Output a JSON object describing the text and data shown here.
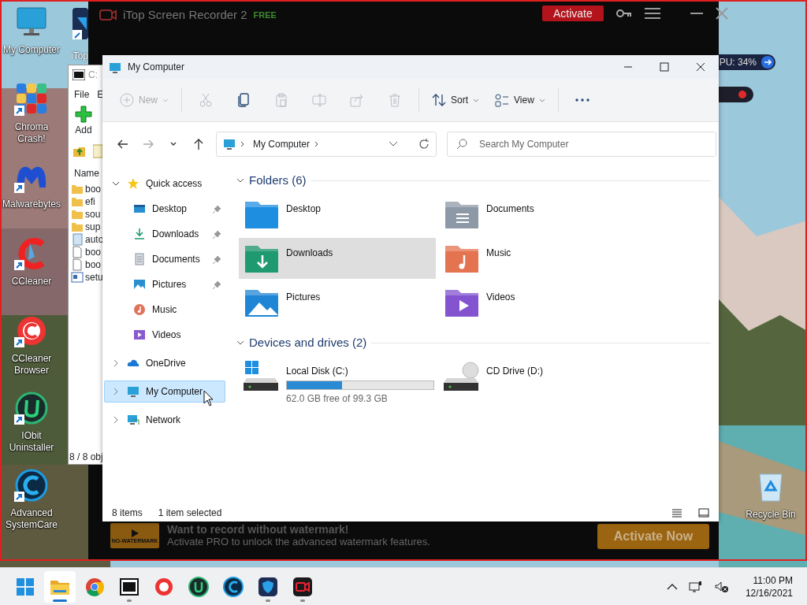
{
  "desktop_icons": [
    {
      "label": "My Computer",
      "kind": "computer"
    },
    {
      "label": "Chroma Crash!",
      "kind": "chroma"
    },
    {
      "label": "Malwarebytes",
      "kind": "malwarebytes"
    },
    {
      "label": "CCleaner",
      "kind": "ccleaner"
    },
    {
      "label": "CCleaner Browser",
      "kind": "ccbrowser"
    },
    {
      "label": "IObit Uninstaller",
      "kind": "iobit"
    },
    {
      "label": "Advanced SystemCare",
      "kind": "asc"
    }
  ],
  "partial_icon": {
    "label": "iTop"
  },
  "recycle_bin": {
    "label": "Recycle Bin"
  },
  "recorder": {
    "title": "iTop Screen Recorder 2",
    "edition": "FREE",
    "activate_button": "Activate",
    "cpu_badge": "PU: 34%",
    "promo": {
      "badge": "NO-WATERMARK",
      "heading": "Want to record without watermark!",
      "text": "Activate PRO to unlock the advanced watermark features.",
      "button": "Activate Now"
    }
  },
  "sevenzip": {
    "title": "C:",
    "menu": [
      "File",
      "E"
    ],
    "add_button": "Add",
    "column": "Name",
    "rows": [
      {
        "name": "boo",
        "kind": "folder"
      },
      {
        "name": "efi",
        "kind": "folder"
      },
      {
        "name": "sou",
        "kind": "folder"
      },
      {
        "name": "sup",
        "kind": "folder"
      },
      {
        "name": "auto",
        "kind": "setup"
      },
      {
        "name": "boo",
        "kind": "file"
      },
      {
        "name": "boo",
        "kind": "file"
      },
      {
        "name": "setu",
        "kind": "app"
      }
    ],
    "status": "8 / 8 obj"
  },
  "explorer": {
    "title": "My Computer",
    "toolbar": [
      [
        {
          "kind": "new",
          "label": "New",
          "disabled": true
        }
      ],
      [
        {
          "kind": "cut",
          "disabled": true
        },
        {
          "kind": "copy",
          "disabled": false
        },
        {
          "kind": "paste",
          "disabled": true
        },
        {
          "kind": "rename",
          "disabled": true
        },
        {
          "kind": "share",
          "disabled": true
        },
        {
          "kind": "delete",
          "disabled": true
        }
      ],
      [
        {
          "kind": "sort",
          "label": "Sort",
          "disabled": false
        },
        {
          "kind": "view",
          "label": "View",
          "disabled": false
        }
      ],
      [
        {
          "kind": "more",
          "disabled": false
        }
      ]
    ],
    "nav_buttons": [
      {
        "kind": "back",
        "disabled": false
      },
      {
        "kind": "forward",
        "disabled": true
      },
      {
        "kind": "recent",
        "disabled": false
      },
      {
        "kind": "up",
        "disabled": false
      }
    ],
    "address": "My Computer",
    "search_placeholder": "Search My Computer",
    "nav": [
      {
        "label": "Quick access",
        "kind": "star",
        "expanded": true,
        "selected": false,
        "children": [
          {
            "label": "Desktop",
            "kind": "desktop",
            "pinned": true,
            "selected": false
          },
          {
            "label": "Downloads",
            "kind": "downloads",
            "pinned": true,
            "selected": false
          },
          {
            "label": "Documents",
            "kind": "documents",
            "pinned": true,
            "selected": false
          },
          {
            "label": "Pictures",
            "kind": "pictures",
            "pinned": true,
            "selected": false
          },
          {
            "label": "Music",
            "kind": "music",
            "pinned": false,
            "selected": false
          },
          {
            "label": "Videos",
            "kind": "videos",
            "pinned": false,
            "selected": false
          }
        ]
      },
      {
        "label": "OneDrive",
        "kind": "cloud",
        "expanded": false,
        "selected": false
      },
      {
        "label": "My Computer",
        "kind": "computer",
        "expanded": false,
        "selected": true
      },
      {
        "label": "Network",
        "kind": "network",
        "expanded": false,
        "selected": false
      }
    ],
    "folders_header": "Folders (6)",
    "folders": [
      {
        "label": "Desktop",
        "kind": "desktop",
        "selected": false
      },
      {
        "label": "Documents",
        "kind": "documents",
        "selected": false
      },
      {
        "label": "Downloads",
        "kind": "downloads",
        "selected": true
      },
      {
        "label": "Music",
        "kind": "music",
        "selected": false
      },
      {
        "label": "Pictures",
        "kind": "pictures",
        "selected": false
      },
      {
        "label": "Videos",
        "kind": "videos",
        "selected": false
      }
    ],
    "drives_header": "Devices and drives (2)",
    "drives": [
      {
        "label": "Local Disk (C:)",
        "kind": "system",
        "level": 0.376,
        "free_text": "62.0 GB free of 99.3 GB"
      },
      {
        "label": "CD Drive (D:)",
        "kind": "cd"
      }
    ],
    "status_items": "8 items",
    "status_selected": "1 item selected"
  },
  "taskbar": {
    "apps": [
      {
        "kind": "start",
        "running": false,
        "selected": false
      },
      {
        "kind": "explorer",
        "running": true,
        "selected": true
      },
      {
        "kind": "chrome",
        "running": false,
        "selected": false
      },
      {
        "kind": "sevenzip",
        "running": true,
        "selected": false
      },
      {
        "kind": "ccbrowser",
        "running": false,
        "selected": false
      },
      {
        "kind": "iobit",
        "running": false,
        "selected": false
      },
      {
        "kind": "asc",
        "running": false,
        "selected": false
      },
      {
        "kind": "shield",
        "running": true,
        "selected": false
      },
      {
        "kind": "recorder",
        "running": true,
        "selected": false
      }
    ],
    "time": "11:00 PM",
    "date": "12/16/2021"
  }
}
